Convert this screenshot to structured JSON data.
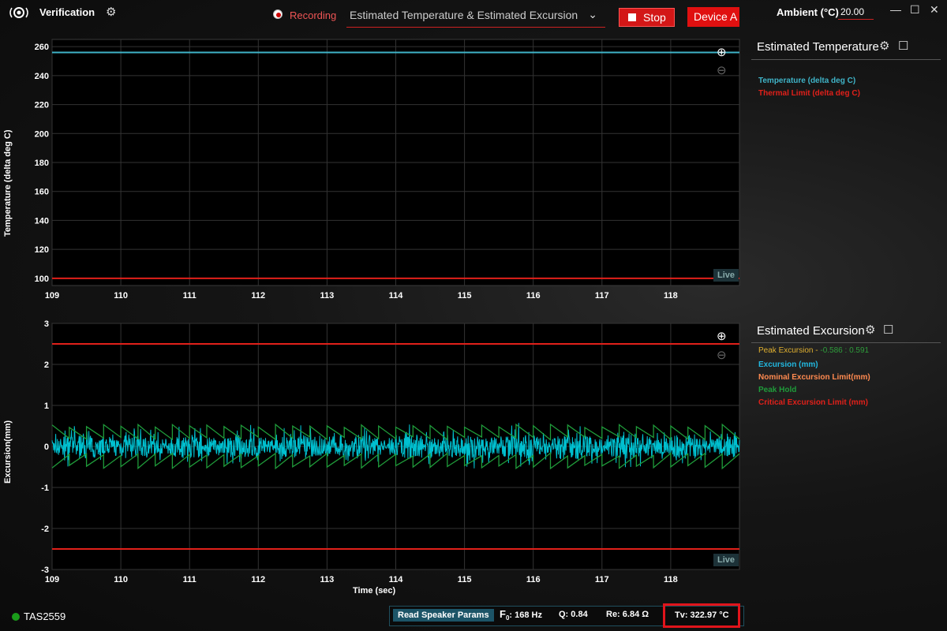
{
  "app": {
    "title": "Verification"
  },
  "header": {
    "recording_label": "Recording",
    "plot_select": "Estimated Temperature & Estimated Excursion",
    "stop_label": "Stop",
    "device_label": "Device A",
    "ambient_label": "Ambient (°C)",
    "ambient_value": "20.00"
  },
  "colors": {
    "accent_red": "#e01010",
    "cyan": "#00c8d8",
    "green": "#1f9b3a"
  },
  "temperature_chart": {
    "ylabel": "Temperature (delta deg C)",
    "live_label": "Live",
    "x_ticks": [
      "109",
      "110",
      "111",
      "112",
      "113",
      "114",
      "115",
      "116",
      "117",
      "118"
    ],
    "y_ticks": [
      "100",
      "120",
      "140",
      "160",
      "180",
      "200",
      "220",
      "240",
      "260"
    ]
  },
  "excursion_chart": {
    "ylabel": "Excursion(mm)",
    "xlabel": "Time (sec)",
    "live_label": "Live",
    "x_ticks": [
      "109",
      "110",
      "111",
      "112",
      "113",
      "114",
      "115",
      "116",
      "117",
      "118"
    ],
    "y_ticks": [
      "3",
      "2",
      "1",
      "0",
      "-1",
      "-2",
      "-3"
    ]
  },
  "chart_data": [
    {
      "type": "line",
      "title": "",
      "xlabel": "",
      "ylabel": "Temperature (delta deg C)",
      "xlim": [
        109,
        119
      ],
      "ylim": [
        95,
        265
      ],
      "grid": true,
      "series": [
        {
          "name": "Temperature (delta deg C)",
          "color": "#3fb4c8",
          "x": [
            109,
            119
          ],
          "y": [
            256,
            256
          ]
        },
        {
          "name": "Thermal Limit (delta deg C)",
          "color": "#e0201a",
          "x": [
            109,
            119
          ],
          "y": [
            100,
            100
          ]
        }
      ]
    },
    {
      "type": "line",
      "title": "",
      "xlabel": "Time (sec)",
      "ylabel": "Excursion(mm)",
      "xlim": [
        109,
        119
      ],
      "ylim": [
        -3,
        3
      ],
      "grid": true,
      "series": [
        {
          "name": "Excursion (mm)",
          "color": "#00c0d0",
          "x": [
            109,
            119
          ],
          "y_range": [
            -0.586,
            0.591
          ]
        },
        {
          "name": "Peak Hold",
          "color": "#1f9b3a",
          "x": [
            109,
            119
          ],
          "y_range": [
            -0.5,
            0.5
          ]
        },
        {
          "name": "Critical Excursion Limit (mm)",
          "color": "#e0201a",
          "x": [
            109,
            119
          ],
          "y": [
            2.5,
            2.5
          ]
        },
        {
          "name": "Critical Excursion Limit (mm)",
          "color": "#e0201a",
          "x": [
            109,
            119
          ],
          "y": [
            -2.5,
            -2.5
          ]
        }
      ]
    }
  ],
  "right_panel": {
    "temp_title": "Estimated Temperature",
    "temp_legend": [
      {
        "label": "Temperature (delta deg C)",
        "color": "#3fb4c8"
      },
      {
        "label": "Thermal Limit (delta deg C)",
        "color": "#e0201a"
      }
    ],
    "exc_title": "Estimated Excursion",
    "peak_label": "Peak Excursion - ",
    "peak_value": "-0.586 : 0.591",
    "exc_legend": [
      {
        "label": "Excursion (mm)",
        "color": "#22b8e0"
      },
      {
        "label": "Nominal Excursion Limit(mm)",
        "color": "#ff8a50"
      },
      {
        "label": "Peak Hold",
        "color": "#1f9b3a"
      },
      {
        "label": "Critical Excursion Limit (mm)",
        "color": "#e0201a"
      }
    ]
  },
  "status": {
    "device": "TAS2559",
    "read_button": "Read Speaker Params",
    "f0_label": "F",
    "f0_sub": "0",
    "f0_value": ": 168 Hz",
    "q": "Q: 0.84",
    "re": "Re: 6.84 Ω",
    "tv": "Tv: 322.97 °C"
  }
}
